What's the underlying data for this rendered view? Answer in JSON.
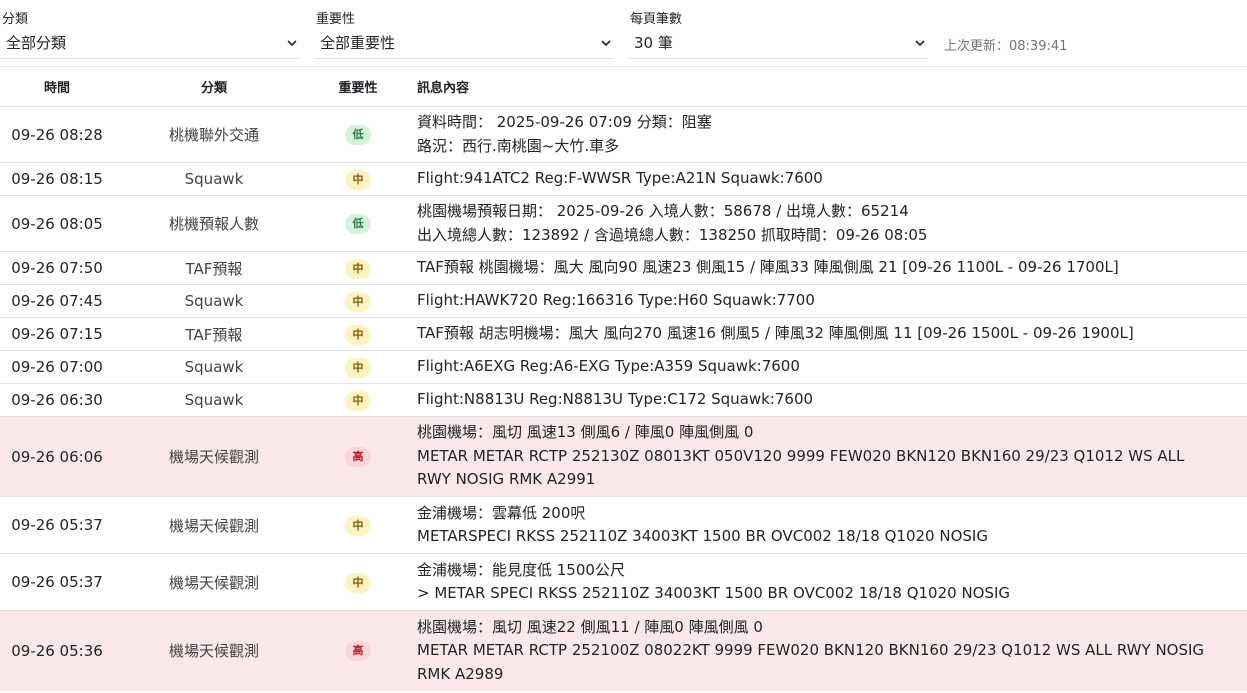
{
  "filters": {
    "category": {
      "label": "分類",
      "value": "全部分類"
    },
    "importance": {
      "label": "重要性",
      "value": "全部重要性"
    },
    "page_size": {
      "label": "每頁筆數",
      "value": "30 筆"
    },
    "last_updated": "上次更新：08:39:41"
  },
  "table": {
    "headers": {
      "time": "時間",
      "category": "分類",
      "importance": "重要性",
      "message": "訊息內容"
    },
    "rows": [
      {
        "time": "09-26 08:28",
        "category": "桃機聯外交通",
        "level": "低",
        "level_class": "low",
        "lines": [
          "資料時間： 2025-09-26 07:09 分類：阻塞",
          "路況：西行.南桃園~大竹.車多"
        ]
      },
      {
        "time": "09-26 08:15",
        "category": "Squawk",
        "level": "中",
        "level_class": "mid",
        "lines": [
          "Flight:941ATC2 Reg:F-WWSR Type:A21N Squawk:7600"
        ]
      },
      {
        "time": "09-26 08:05",
        "category": "桃機預報人數",
        "level": "低",
        "level_class": "low",
        "lines": [
          "桃園機場預報日期： 2025-09-26 入境人數：58678 / 出境人數：65214",
          "出入境總人數：123892 / 含過境總人數：138250 抓取時間：09-26 08:05"
        ]
      },
      {
        "time": "09-26 07:50",
        "category": "TAF預報",
        "level": "中",
        "level_class": "mid",
        "lines": [
          "TAF預報 桃園機場：風大 風向90 風速23 側風15 / 陣風33 陣風側風 21 [09-26 1100L - 09-26 1700L]"
        ]
      },
      {
        "time": "09-26 07:45",
        "category": "Squawk",
        "level": "中",
        "level_class": "mid",
        "lines": [
          "Flight:HAWK720 Reg:166316 Type:H60 Squawk:7700"
        ]
      },
      {
        "time": "09-26 07:15",
        "category": "TAF預報",
        "level": "中",
        "level_class": "mid",
        "lines": [
          "TAF預報 胡志明機場：風大 風向270 風速16 側風5 / 陣風32 陣風側風 11 [09-26 1500L - 09-26 1900L]"
        ]
      },
      {
        "time": "09-26 07:00",
        "category": "Squawk",
        "level": "中",
        "level_class": "mid",
        "lines": [
          "Flight:A6EXG Reg:A6-EXG Type:A359 Squawk:7600"
        ]
      },
      {
        "time": "09-26 06:30",
        "category": "Squawk",
        "level": "中",
        "level_class": "mid",
        "lines": [
          "Flight:N8813U Reg:N8813U Type:C172 Squawk:7600"
        ]
      },
      {
        "time": "09-26 06:06",
        "category": "機場天候觀測",
        "level": "高",
        "level_class": "high",
        "lines": [
          "桃園機場：風切 風速13 側風6 / 陣風0 陣風側風 0",
          "METAR METAR RCTP 252130Z 08013KT 050V120 9999 FEW020 BKN120 BKN160 29/23 Q1012 WS ALL",
          "RWY NOSIG RMK A2991"
        ]
      },
      {
        "time": "09-26 05:37",
        "category": "機場天候觀測",
        "level": "中",
        "level_class": "mid",
        "lines": [
          "金浦機場：雲幕低 200呎",
          "METARSPECI RKSS 252110Z 34003KT 1500 BR OVC002 18/18 Q1020 NOSIG"
        ]
      },
      {
        "time": "09-26 05:37",
        "category": "機場天候觀測",
        "level": "中",
        "level_class": "mid",
        "lines": [
          "金浦機場：能見度低 1500公尺",
          "> METAR SPECI RKSS 252110Z 34003KT 1500 BR OVC002 18/18 Q1020 NOSIG"
        ]
      },
      {
        "time": "09-26 05:36",
        "category": "機場天候觀測",
        "level": "高",
        "level_class": "high",
        "lines": [
          "桃園機場：風切 風速22 側風11 / 陣風0 陣風側風 0",
          "METAR METAR RCTP 252100Z 08022KT 9999 FEW020 BKN120 BKN160 29/23 Q1012 WS ALL RWY NOSIG",
          "RMK A2989"
        ]
      }
    ]
  }
}
